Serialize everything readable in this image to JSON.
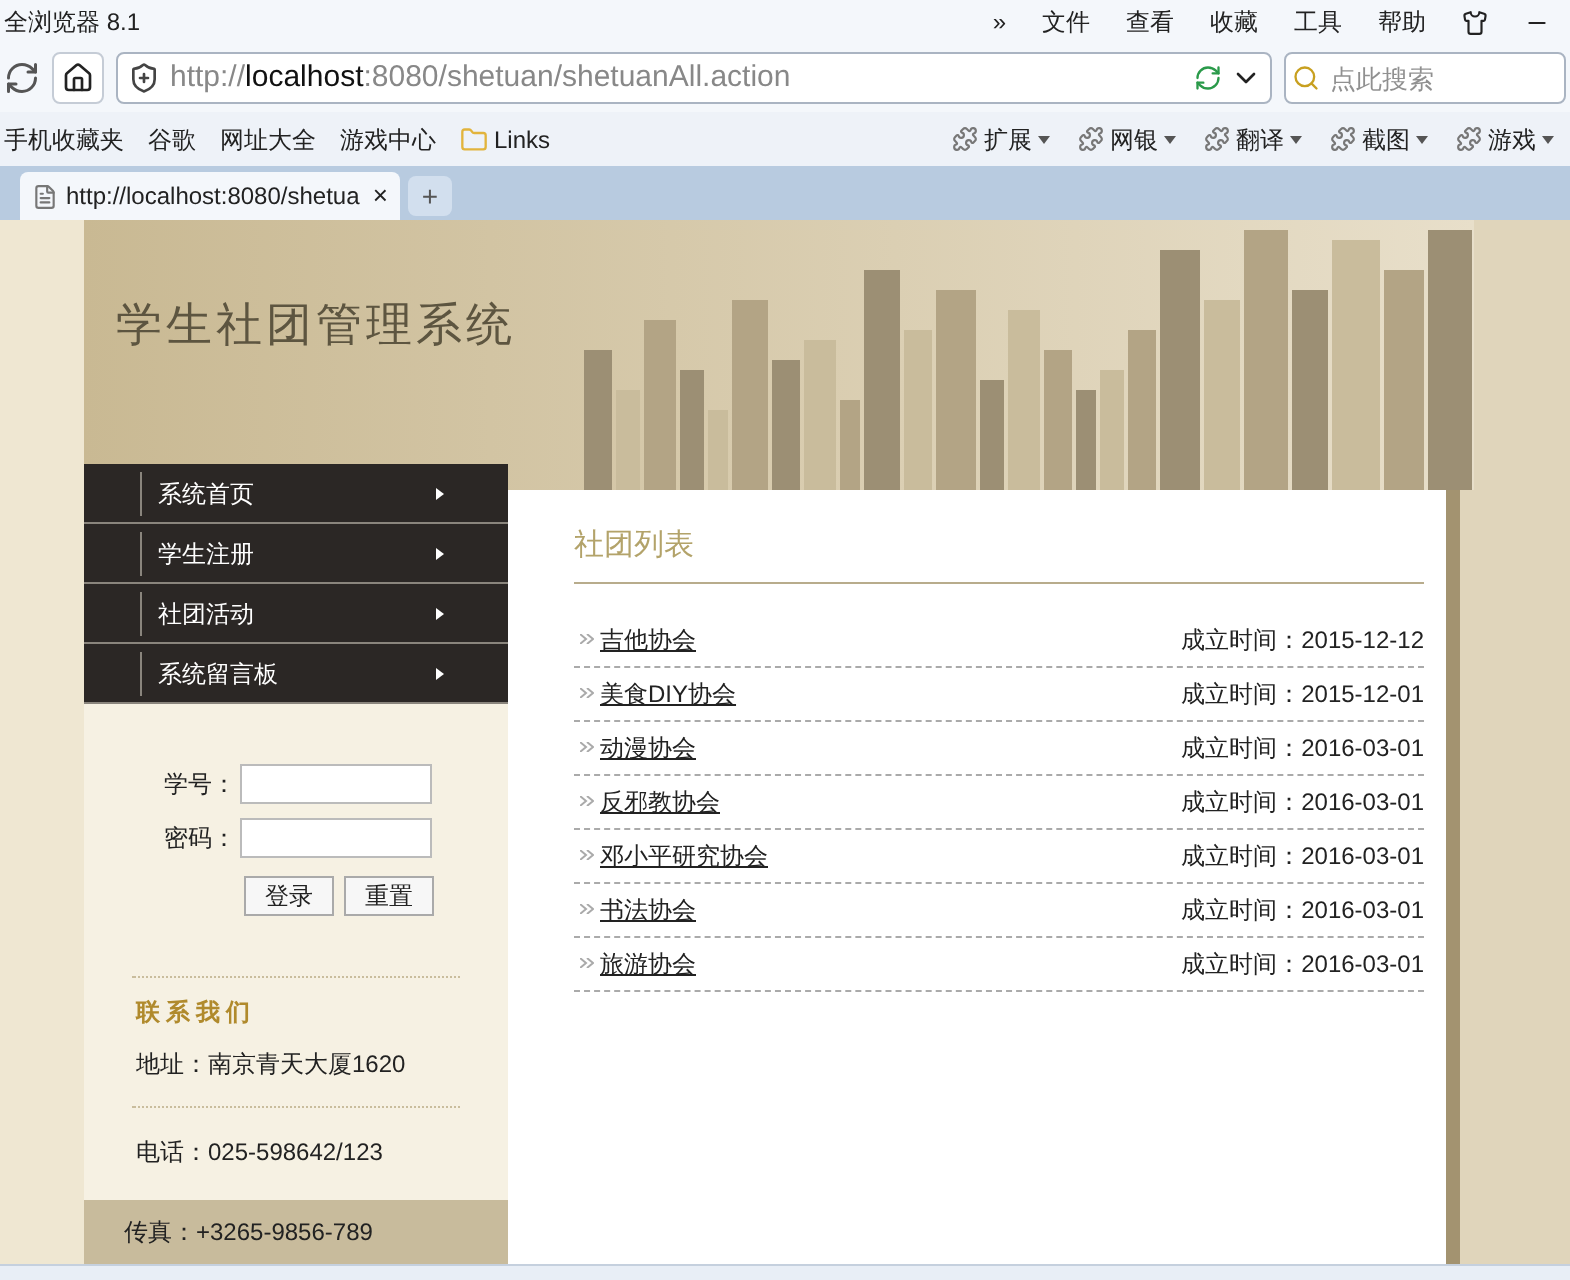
{
  "browser": {
    "title": "全浏览器 8.1",
    "menu": [
      "»",
      "文件",
      "查看",
      "收藏",
      "工具",
      "帮助"
    ],
    "address": "http://**localhost**:8080/shetuan/shetuanAll.action",
    "search": {
      "placeholder": "点此搜索"
    },
    "bookmarks": [
      "手机收藏夹",
      "谷歌",
      "网址大全",
      "游戏中心",
      "Links"
    ],
    "tools": [
      "扩展",
      "网银",
      "翻译",
      "截图",
      "游戏"
    ],
    "tab": {
      "label": "http://localhost:8080/shetua",
      "close": "×",
      "new": "+"
    }
  },
  "page": {
    "site_title": "学生社团管理系统",
    "nav": [
      {
        "label": "系统首页"
      },
      {
        "label": "学生注册"
      },
      {
        "label": "社团活动"
      },
      {
        "label": "系统留言板"
      }
    ],
    "login": {
      "fields": [
        {
          "label": "学号："
        },
        {
          "label": "密码："
        }
      ],
      "buttons": [
        "登录",
        "重置"
      ]
    },
    "contact": {
      "title": "联系我们",
      "address": "地址：南京青天大厦1620",
      "phone": "电话：025-598642/123",
      "fax": "传真：+3265-9856-789"
    },
    "list_title": "社团列表",
    "clubs": [
      {
        "name": "吉他协会",
        "date_label": "成立时间：",
        "date": "2015-12-12"
      },
      {
        "name": "美食DIY协会",
        "date_label": "成立时间：",
        "date": "2015-12-01"
      },
      {
        "name": "动漫协会",
        "date_label": "成立时间：",
        "date": "2016-03-01"
      },
      {
        "name": "反邪教协会",
        "date_label": "成立时间：",
        "date": "2016-03-01"
      },
      {
        "name": "邓小平研究协会",
        "date_label": "成立时间：",
        "date": "2016-03-01"
      },
      {
        "name": "书法协会",
        "date_label": "成立时间：",
        "date": "2016-03-01"
      },
      {
        "name": "旅游协会",
        "date_label": "成立时间：",
        "date": "2016-03-01"
      }
    ]
  }
}
